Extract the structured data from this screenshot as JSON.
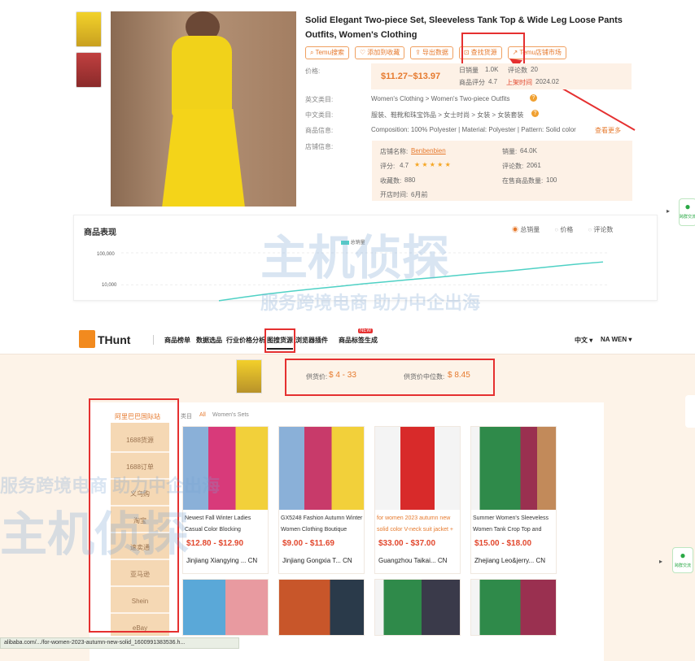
{
  "product": {
    "title": "Solid Elegant Two-piece Set, Sleeveless Tank Top & Wide Leg Loose Pants Outfits, Women's Clothing",
    "buttons": [
      "Temu搜索",
      "添加到收藏",
      "导出数据",
      "查找货源",
      "Temu店铺市场"
    ],
    "price_label": "价格:",
    "price": "$11.27~$13.97",
    "sales_label": "日销量",
    "sales_value": "1.0K",
    "reviews_label": "评论数",
    "reviews_value": "20",
    "rating_label": "商品评分",
    "rating_value": "4.7",
    "listed_label": "上架时间",
    "listed_value": "2024.02",
    "en_cat_label": "英文类目:",
    "en_cat": "Women's Clothing > Women's Two-piece Outfits",
    "cn_cat_label": "中文类目:",
    "cn_cat": "服装、鞋靴和珠宝饰品 > 女士时尚 > 女装 > 女装套装",
    "info_label": "商品信息:",
    "info": "Composition: 100% Polyester | Material: Polyester | Pattern: Solid color",
    "info_link": "查看更多",
    "shop_label": "店铺信息:",
    "shop": {
      "name_label": "店铺名称:",
      "name": "Benbenbien",
      "sales_label": "销量:",
      "sales": "64.0K",
      "score_label": "评分:",
      "score": "4.7",
      "stars": "★ ★ ★ ★ ★",
      "review_label": "评论数:",
      "review": "2061",
      "follow_label": "收藏数:",
      "follow": "880",
      "items_label": "在售商品数量:",
      "items": "100",
      "open_label": "开店时间:",
      "open": "6月前"
    }
  },
  "chart": {
    "title": "商品表现",
    "legend": "总销量",
    "tabs": [
      "总销量",
      "价格",
      "评论数"
    ],
    "y_ticks": [
      "100,000",
      "10,000"
    ]
  },
  "chart_data": {
    "type": "line",
    "series": [
      {
        "name": "总销量",
        "values": [
          3200,
          4100,
          5200,
          6300,
          7600,
          9000,
          10800,
          12600,
          14700,
          17000,
          20000,
          23500,
          27000,
          32000,
          38000,
          45000,
          52000
        ]
      }
    ],
    "y_scale": "log",
    "ylim": [
      3000,
      100000
    ]
  },
  "nav": {
    "logo": "THunt",
    "items": [
      "商品榜单",
      "数据选品",
      "行业价格分析",
      "图搜货源",
      "浏览器插件",
      "商品标签生成"
    ],
    "new_badge": "NEW",
    "lang": "中文",
    "user": "NA WEN"
  },
  "supply": {
    "price_label": "供货价:",
    "price": "$ 4 - 33",
    "median_label": "供货价中位数:",
    "median": "$ 8.45",
    "sidebar_title": "阿里巴巴国际站",
    "sidebar": [
      "1688货源",
      "1688订单",
      "义乌购",
      "淘宝",
      "速卖通",
      "亚马逊",
      "Shein",
      "eBay"
    ],
    "category_label": "类目",
    "category_tabs": [
      "All",
      "Women's Sets"
    ],
    "products": [
      {
        "name": "Newest Fall Winter Ladies Casual Color Blocking",
        "price": "$12.80 - $12.90",
        "supplier": "Jinjiang Xiangying ...",
        "country": "CN"
      },
      {
        "name": "GX5248 Fashion Autumn Winter Women Clothing Boutique",
        "price": "$9.00 - $11.69",
        "supplier": "Jinjiang Gongxia T...",
        "country": "CN"
      },
      {
        "name": "for women 2023 autumn new solid color V-neck suit jacket +",
        "price": "$33.00 - $37.00",
        "supplier": "Guangzhou Taikai...",
        "country": "CN"
      },
      {
        "name": "Summer Women's Sleeveless Women Tank Crop Top and",
        "price": "$15.00 - $18.00",
        "supplier": "Zhejiang Leo&jerry...",
        "country": "CN"
      }
    ]
  },
  "status_url": "alibaba.com/.../for-women-2023-autumn-new-solid_1600991383536.h...",
  "watermark": {
    "brand": "主机侦探",
    "slogan": "服务跨境电商 助力中企出海"
  },
  "widget_text": "跨群交流",
  "colors": {
    "accent": "#e67a2e",
    "price_red": "#e2482e",
    "annotation_red": "#e53030",
    "line": "#4fd1c5"
  }
}
